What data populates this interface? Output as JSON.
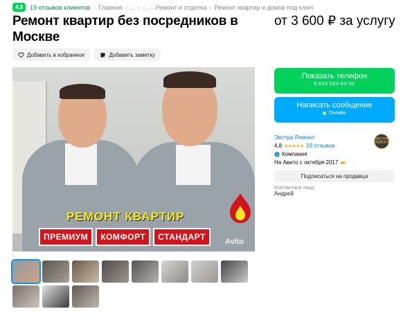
{
  "topline": {
    "rating": "4,8",
    "reviews": "19 отзывов клиентов",
    "breadcrumbs": [
      "Главная",
      "...",
      "...",
      "Ремонт и отделка",
      "Ремонт квартир и домов под ключ"
    ]
  },
  "listing": {
    "title": "Ремонт квартир без посредников в Москве",
    "price": "от 3 600 ₽ за услугу",
    "favorite_label": "Добавить в избранное",
    "note_label": "Добавить заметку"
  },
  "photo": {
    "caption": "РЕМОНТ КВАРТИР",
    "chips": [
      "ПРЕМИУМ",
      "КОМФОРТ",
      "СТАНДАРТ"
    ],
    "watermark": "Avito",
    "hoodie_text": "EKSTRAREMONT"
  },
  "thumbnails": [
    {
      "colors": [
        "#8f9aa3",
        "#d2a283"
      ]
    },
    {
      "colors": [
        "#5b5550",
        "#a89f96"
      ]
    },
    {
      "colors": [
        "#6a5a4c",
        "#c9b9a6"
      ]
    },
    {
      "colors": [
        "#4f4b48",
        "#9c958d"
      ]
    },
    {
      "colors": [
        "#555353",
        "#b7b1aa"
      ]
    },
    {
      "colors": [
        "#d7d5d2",
        "#8e8b87"
      ]
    },
    {
      "colors": [
        "#cfcfcd",
        "#9b9995"
      ]
    },
    {
      "colors": [
        "#464646",
        "#c9c9c9"
      ]
    },
    {
      "colors": [
        "#7a7068",
        "#cdc4ba"
      ]
    },
    {
      "colors": [
        "#e2e2e2",
        "#3a3a3a"
      ]
    },
    {
      "colors": [
        "#5d5953",
        "#c1b8ad"
      ]
    }
  ],
  "contact": {
    "phone_button": "Показать телефон",
    "phone_mask": "8 XXX XXX-XX-XX",
    "message_button": "Написать сообщение",
    "online": "Онлайн"
  },
  "seller": {
    "name": "Экстра Ремонт",
    "rating": "4,8",
    "stars": "★★★★★",
    "reviews": "19 отзывов",
    "type": "Компания",
    "since": "На Авито с октября 2017",
    "logo_text": "ЭКСТРА РЕМОНТ",
    "subscribe_button": "Подписаться на продавца",
    "contact_label": "Контактное лицо",
    "contact_name": "Андрей"
  },
  "colors": {
    "green": "#02d15c",
    "blue": "#00aaff",
    "link": "#0a7ed6",
    "red": "#d4141c",
    "yellow": "#f7ea1e"
  }
}
